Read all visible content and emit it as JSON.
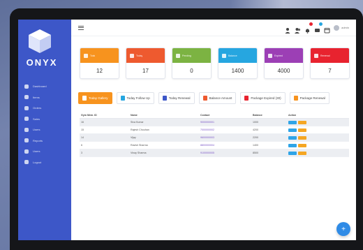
{
  "app": {
    "brand": "ONYX"
  },
  "sidebar": {
    "items": [
      {
        "label": "Dashboard"
      },
      {
        "label": "Items"
      },
      {
        "label": "Orders"
      },
      {
        "label": "Sales"
      },
      {
        "label": "Users"
      },
      {
        "label": "Reports"
      },
      {
        "label": "Users"
      },
      {
        "label": "Logout"
      }
    ]
  },
  "topbar": {
    "user_name": "admin"
  },
  "cards": [
    {
      "title": "Total",
      "value": "12",
      "color": "#f7931e"
    },
    {
      "title": "Today",
      "value": "17",
      "color": "#ee5a2f"
    },
    {
      "title": "Pending",
      "value": "0",
      "color": "#7cb342"
    },
    {
      "title": "Balance",
      "value": "1400",
      "color": "#26a6e0"
    },
    {
      "title": "Expired",
      "value": "4000",
      "color": "#9c3fb5"
    },
    {
      "title": "Renewal",
      "value": "7",
      "color": "#e8232f"
    }
  ],
  "tabs": [
    {
      "label": "Today Gallery",
      "icon_color": "#ffffff"
    },
    {
      "label": "Today Follow Up",
      "icon_color": "#26a6e0"
    },
    {
      "label": "Today Renewal",
      "icon_color": "#3d57c8"
    },
    {
      "label": "Balance Amount",
      "icon_color": "#ee5a2f"
    },
    {
      "label": "Package Expired (30)",
      "icon_color": "#e8232f"
    },
    {
      "label": "Package Renewal",
      "icon_color": "#f7931e"
    }
  ],
  "table": {
    "headers": [
      "Gym Mem. ID",
      "Name",
      "Contact",
      "Balance",
      "Action"
    ],
    "rows": [
      {
        "id": "16",
        "name": "Siva Kumar",
        "contact": "9000000001",
        "balance": "1000"
      },
      {
        "id": "15",
        "name": "Rajesh Chouhan",
        "contact": "7000000002",
        "balance": "4200"
      },
      {
        "id": "14",
        "name": "Vijay",
        "contact": "9600000003",
        "balance": "2200"
      },
      {
        "id": "6",
        "name": "Ravish Sharma",
        "contact": "8800000004",
        "balance": "1400"
      },
      {
        "id": "3",
        "name": "Vinay Sharma",
        "contact": "9100000005",
        "balance": "8500"
      }
    ]
  },
  "actions": {
    "view": "View",
    "edit": "Edit"
  },
  "fab": {
    "label": "+"
  }
}
